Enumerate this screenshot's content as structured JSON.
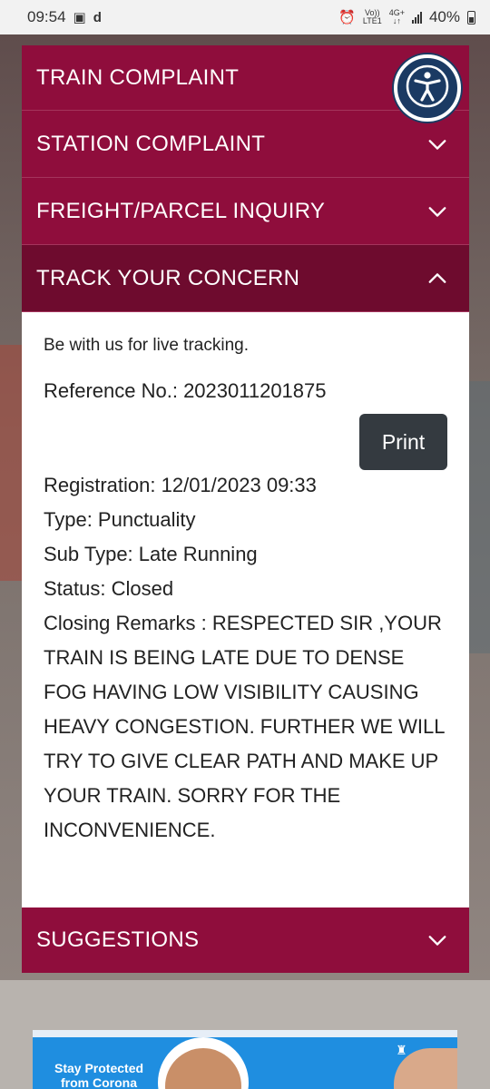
{
  "status_bar": {
    "time": "09:54",
    "network_top": "Vo))",
    "network_bottom": "LTE1",
    "gen_top": "4G+",
    "battery_pct": "40%"
  },
  "accordion": {
    "train_complaint": "TRAIN COMPLAINT",
    "station_complaint": "STATION COMPLAINT",
    "freight_inquiry": "FREIGHT/PARCEL INQUIRY",
    "track_concern": "TRACK YOUR CONCERN",
    "suggestions": "SUGGESTIONS"
  },
  "tracking": {
    "intro": "Be with us for live tracking.",
    "reference": "Reference No.: 2023011201875",
    "print_label": "Print",
    "registration": "Registration: 12/01/2023 09:33",
    "type": "Type: Punctuality",
    "sub_type": "Sub Type: Late Running",
    "status": "Status: Closed",
    "closing_remarks": "Closing Remarks : RESPECTED SIR ,YOUR TRAIN IS BEING LATE DUE TO DENSE FOG HAVING LOW VISIBILITY CAUSING HEAVY CONGESTION. FURTHER WE WILL TRY TO GIVE CLEAR PATH AND MAKE UP YOUR TRAIN. SORRY FOR THE INCONVENIENCE."
  },
  "banner": {
    "line1": "Stay Protected",
    "line2": "from Corona"
  },
  "colors": {
    "accordion_bg": "#8f0d3c",
    "accordion_active_bg": "#6e0b2e",
    "print_button_bg": "#343a40",
    "accessibility_bg": "#1b3a63"
  },
  "icons": {
    "chevron": "chevron-down-icon",
    "chevron_active": "chevron-up-icon",
    "accessibility": "accessibility-icon"
  }
}
